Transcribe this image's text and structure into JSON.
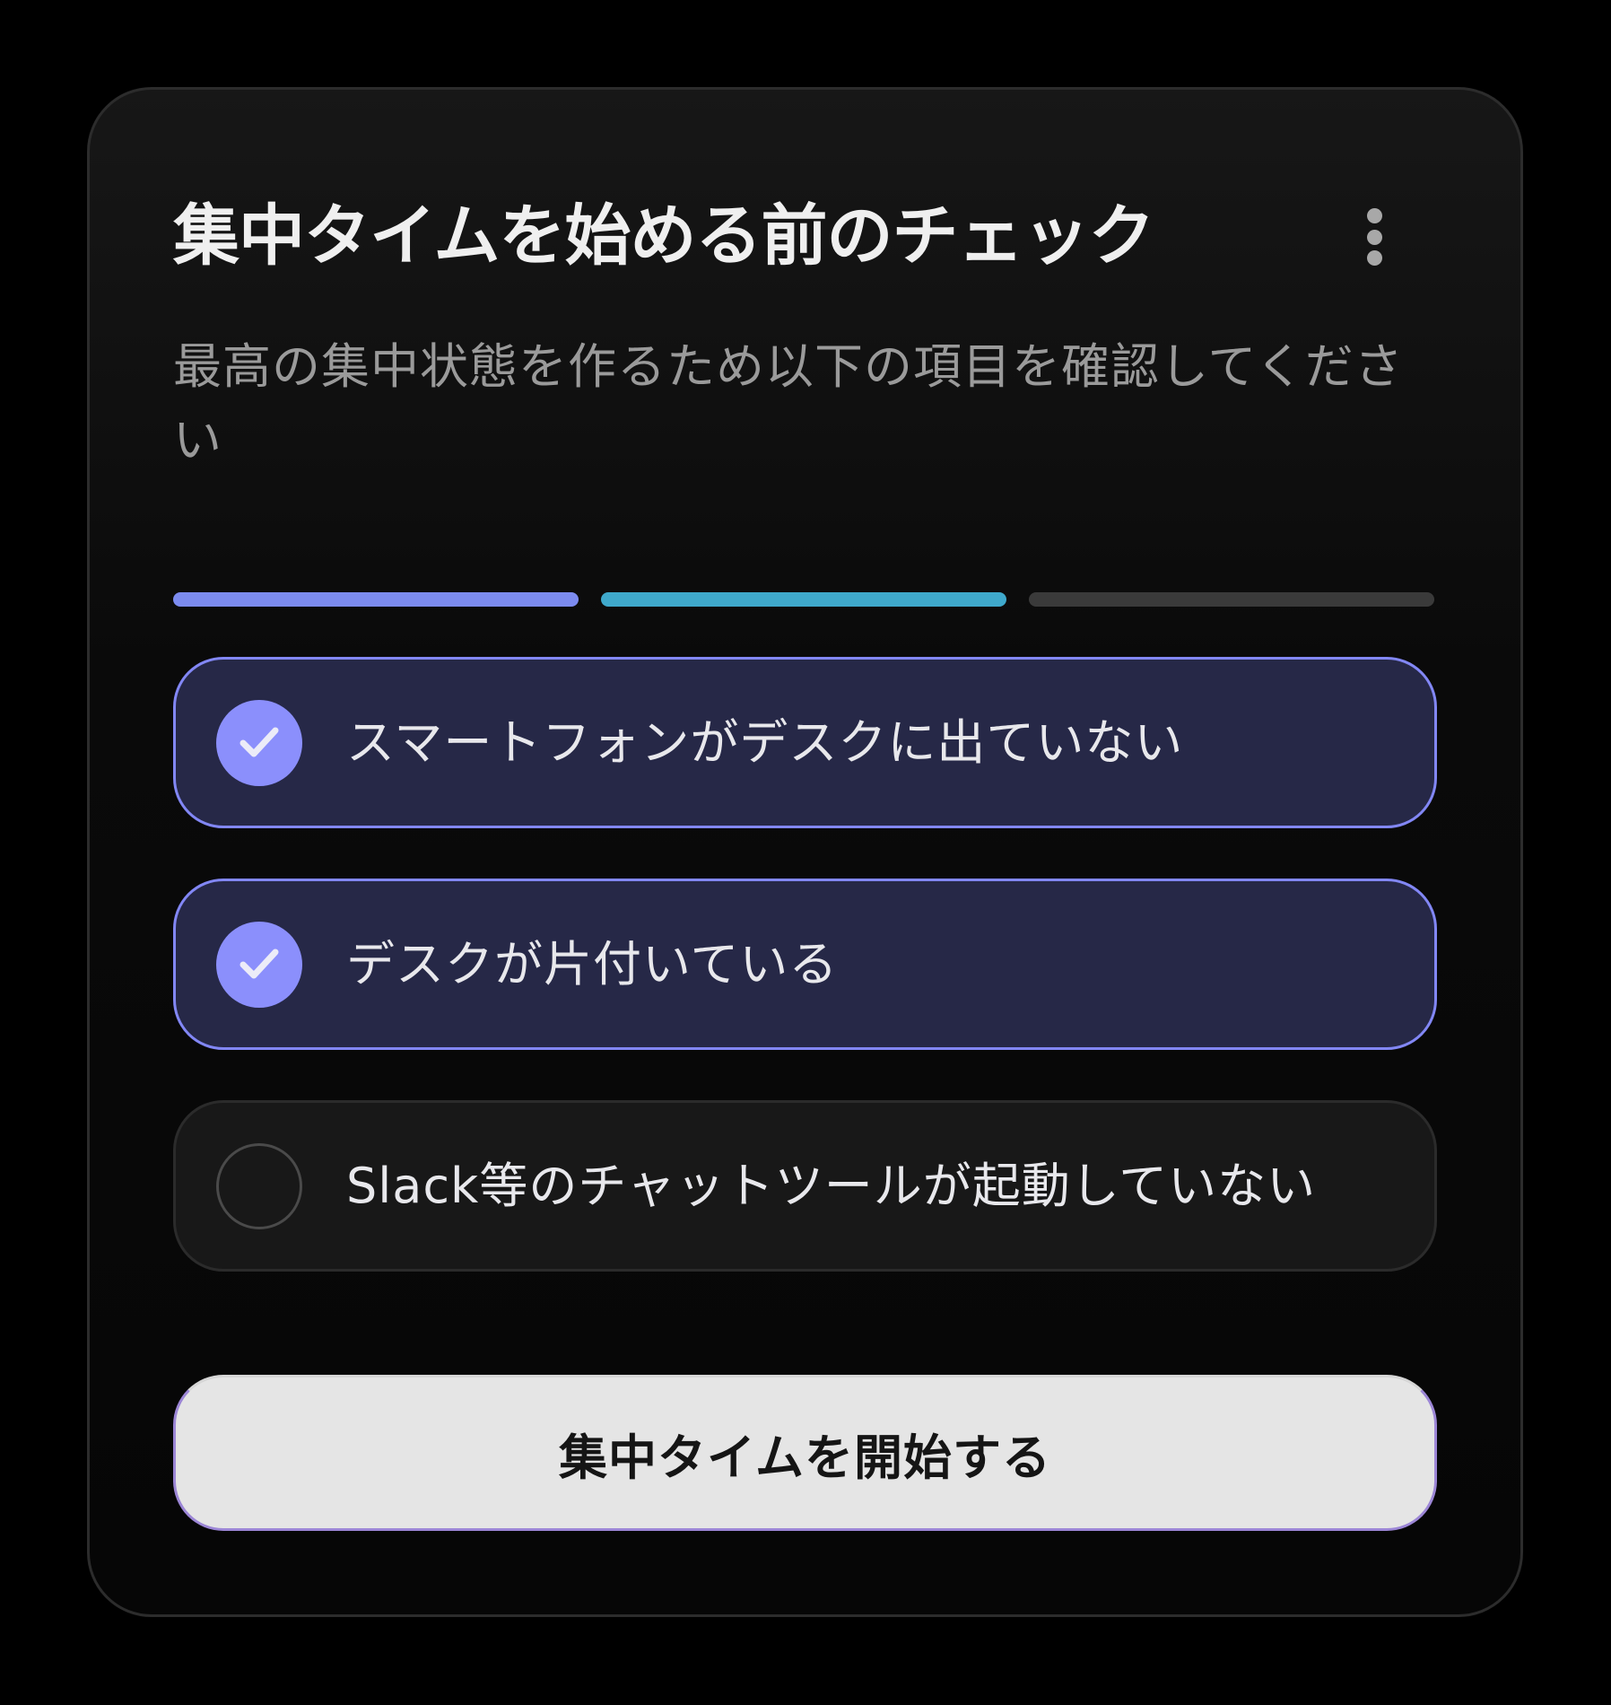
{
  "header": {
    "title": "集中タイムを始める前のチェック",
    "more_icon": "more-vertical-icon"
  },
  "subtitle": "最高の集中状態を作るため以下の項目を確認してください",
  "progress": {
    "total_steps": 3,
    "completed_steps": 2,
    "segment_colors": [
      "#7c8bf0",
      "#3fa9cc",
      "#3a3a3a"
    ]
  },
  "checklist": [
    {
      "label": "スマートフォンがデスクに出ていない",
      "checked": true
    },
    {
      "label": "デスクが片付いている",
      "checked": true
    },
    {
      "label": "Slack等のチャットツールが起動していない",
      "checked": false
    }
  ],
  "start_button": {
    "label": "集中タイムを開始する"
  },
  "colors": {
    "accent": "#8b8ffc",
    "checked_background": "#262847",
    "checked_border": "#8287f5"
  }
}
